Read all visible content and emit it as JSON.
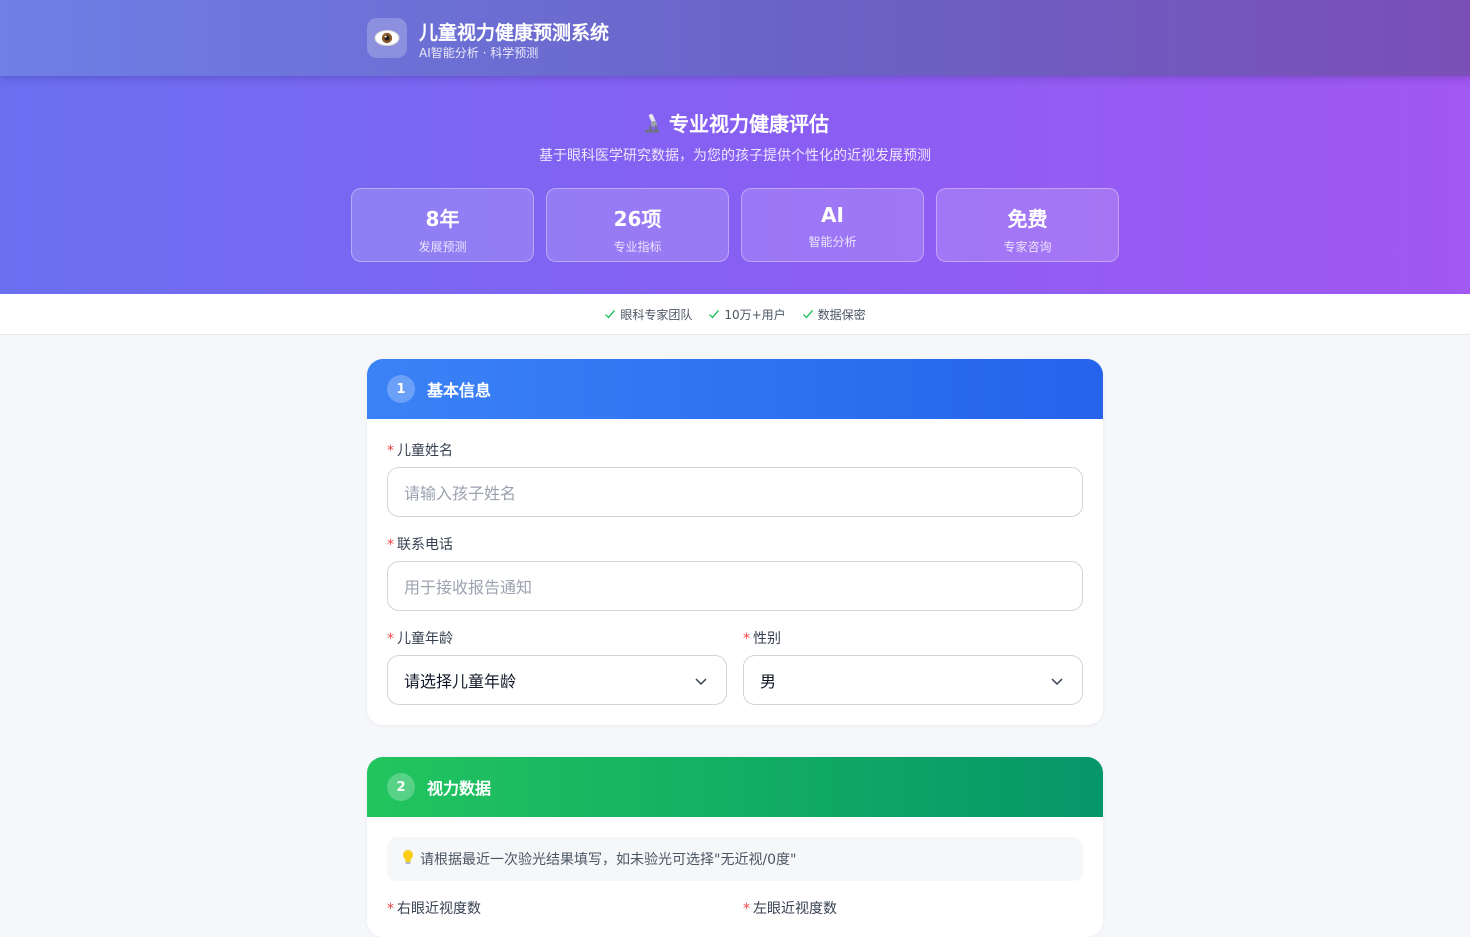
{
  "header": {
    "logo_icon": "eye-icon",
    "title": "儿童视力健康预测系统",
    "subtitle": "AI智能分析 · 科学预测"
  },
  "hero": {
    "title_icon": "microscope-icon",
    "title": "专业视力健康评估",
    "subtitle": "基于眼科医学研究数据，为您的孩子提供个性化的近视发展预测",
    "stats": [
      {
        "value": "8年",
        "label": "发展预测"
      },
      {
        "value": "26项",
        "label": "专业指标"
      },
      {
        "value": "AI",
        "label": "智能分析"
      },
      {
        "value": "免费",
        "label": "专家咨询"
      }
    ]
  },
  "trust": {
    "icon": "check-icon",
    "color": "#22c55e",
    "items": [
      "眼科专家团队",
      "10万+用户",
      "数据保密"
    ]
  },
  "section1": {
    "number": "1",
    "title": "基本信息",
    "color": "#3b82f6",
    "required_mark": "*",
    "name_label": "儿童姓名",
    "name_placeholder": "请输入孩子姓名",
    "phone_label": "联系电话",
    "phone_placeholder": "用于接收报告通知",
    "age_label": "儿童年龄",
    "age_value": "请选择儿童年龄",
    "gender_label": "性别",
    "gender_value": "男"
  },
  "section2": {
    "number": "2",
    "title": "视力数据",
    "color": "#22c55e",
    "tip_icon": "lightbulb-icon",
    "tip": "请根据最近一次验光结果填写，如未验光可选择\"无近视/0度\"",
    "required_mark": "*",
    "right_label": "右眼近视度数",
    "left_label": "左眼近视度数"
  }
}
